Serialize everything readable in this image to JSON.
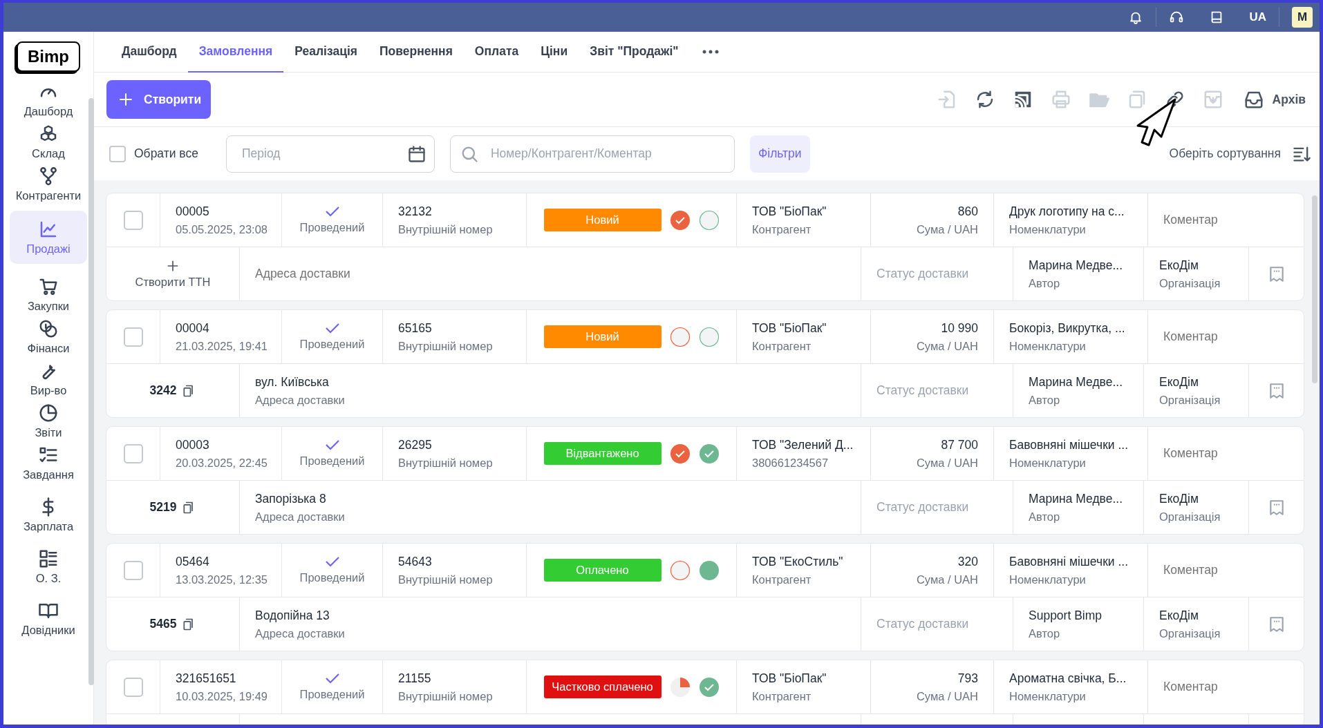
{
  "topbar": {
    "language": "UA",
    "avatar": "M"
  },
  "logo": "Bimp",
  "sidebar": {
    "items": [
      {
        "label": "Дашборд",
        "selected": false
      },
      {
        "label": "Склад",
        "selected": false
      },
      {
        "label": "Контрагенти",
        "selected": false
      },
      {
        "label": "Продажі",
        "selected": true
      },
      {
        "label": "Закупки",
        "selected": false
      },
      {
        "label": "Фінанси",
        "selected": false
      },
      {
        "label": "Вир-во",
        "selected": false
      },
      {
        "label": "Звіти",
        "selected": false
      },
      {
        "label": "Завдання",
        "selected": false
      },
      {
        "label": "Зарплата",
        "selected": false
      },
      {
        "label": "О. З.",
        "selected": false
      },
      {
        "label": "Довідники",
        "selected": false
      }
    ]
  },
  "tabs": [
    {
      "label": "Дашборд",
      "selected": false
    },
    {
      "label": "Замовлення",
      "selected": true
    },
    {
      "label": "Реалізація",
      "selected": false
    },
    {
      "label": "Повернення",
      "selected": false
    },
    {
      "label": "Оплата",
      "selected": false
    },
    {
      "label": "Ціни",
      "selected": false
    },
    {
      "label": "Звіт \"Продажі\"",
      "selected": false
    }
  ],
  "toolbar": {
    "create_button": "Створити",
    "tools": [
      {
        "disabled": true
      },
      {
        "disabled": false
      },
      {
        "disabled": false
      },
      {
        "disabled": true
      },
      {
        "disabled": true
      },
      {
        "disabled": true
      },
      {
        "disabled": false
      },
      {
        "disabled": true
      }
    ],
    "archive_label": "Архів"
  },
  "filters": {
    "select_all": {
      "label": "Обрати все",
      "checked": false
    },
    "period": {
      "placeholder": "Період"
    },
    "search": {
      "placeholder": "Номер/Контрагент/Коментар"
    },
    "filter_button": "Фільтри",
    "sort_label": "Оберіть сортування"
  },
  "orders": [
    {
      "checked": false,
      "number": "00005",
      "date": "05.05.2025, 23:08",
      "posted": "Проведений",
      "internal_number": "32132",
      "internal_label": "Внутрішній номер",
      "status": {
        "label": "Новий",
        "color": "#ff8a00"
      },
      "payment": {
        "paid": true,
        "partial": false
      },
      "shipment": {
        "filled": false,
        "checked": false
      },
      "contractor": "ТОВ \"БіоПак\"",
      "contractor_sub": "Контрагент",
      "sum": "860",
      "sum_label": "Сума / UAH",
      "items": "Друк логотипу на с...",
      "items_label": "Номенклатури",
      "comment": {
        "placeholder": "Коментар"
      },
      "ttn": {
        "kind": "create",
        "label": "Створити ТТН"
      },
      "address": {
        "placeholder": "Адреса доставки"
      },
      "delivery_status": {
        "placeholder": "Статус доставки"
      },
      "author": "Марина Медве...",
      "author_label": "Автор",
      "organization": "ЕкоДім",
      "organization_label": "Організація"
    },
    {
      "checked": false,
      "number": "00004",
      "date": "21.03.2025, 19:41",
      "posted": "Проведений",
      "internal_number": "65165",
      "internal_label": "Внутрішній номер",
      "status": {
        "label": "Новий",
        "color": "#ff8a00"
      },
      "payment": {
        "paid": false,
        "partial": false
      },
      "shipment": {
        "filled": false,
        "checked": false
      },
      "contractor": "ТОВ \"БіоПак\"",
      "contractor_sub": "Контрагент",
      "sum": "10 990",
      "sum_label": "Сума / UAH",
      "items": "Бокоріз, Викрутка, ...",
      "items_label": "Номенклатури",
      "comment": {
        "placeholder": "Коментар"
      },
      "ttn": {
        "kind": "number",
        "label": "3242"
      },
      "address": {
        "value": "вул. Київська",
        "label": "Адреса доставки"
      },
      "delivery_status": {
        "placeholder": "Статус доставки"
      },
      "author": "Марина Медве...",
      "author_label": "Автор",
      "organization": "ЕкоДім",
      "organization_label": "Організація"
    },
    {
      "checked": false,
      "number": "00003",
      "date": "20.03.2025, 22:45",
      "posted": "Проведений",
      "internal_number": "26295",
      "internal_label": "Внутрішній номер",
      "status": {
        "label": "Відвантажено",
        "color": "#33cc33"
      },
      "payment": {
        "paid": true,
        "partial": false
      },
      "shipment": {
        "filled": true,
        "checked": true
      },
      "contractor": "ТОВ \"Зелений Д...",
      "contractor_sub": "380661234567",
      "sum": "87 700",
      "sum_label": "Сума / UAH",
      "items": "Бавовняні мішечки ...",
      "items_label": "Номенклатури",
      "comment": {
        "placeholder": "Коментар"
      },
      "ttn": {
        "kind": "number",
        "label": "5219"
      },
      "address": {
        "value": "Запорізька 8",
        "label": "Адреса доставки"
      },
      "delivery_status": {
        "placeholder": "Статус доставки"
      },
      "author": "Марина Медве...",
      "author_label": "Автор",
      "organization": "ЕкоДім",
      "organization_label": "Організація"
    },
    {
      "checked": false,
      "number": "05464",
      "date": "13.03.2025, 12:35",
      "posted": "Проведений",
      "internal_number": "54643",
      "internal_label": "Внутрішній номер",
      "status": {
        "label": "Оплачено",
        "color": "#33cc33"
      },
      "payment": {
        "paid": false,
        "partial": false
      },
      "shipment": {
        "filled": true,
        "checked": false
      },
      "contractor": "ТОВ \"ЕкоСтиль\"",
      "contractor_sub": "Контрагент",
      "sum": "320",
      "sum_label": "Сума / UAH",
      "items": "Бавовняні мішечки ...",
      "items_label": "Номенклатури",
      "comment": {
        "placeholder": "Коментар"
      },
      "ttn": {
        "kind": "number",
        "label": "5465"
      },
      "address": {
        "value": "Водопійна 13",
        "label": "Адреса доставки"
      },
      "delivery_status": {
        "placeholder": "Статус доставки"
      },
      "author": "Support Bimp",
      "author_label": "Автор",
      "organization": "ЕкоДім",
      "organization_label": "Організація"
    },
    {
      "checked": false,
      "number": "321651651",
      "date": "10.03.2025, 19:49",
      "posted": "Проведений",
      "internal_number": "21155",
      "internal_label": "Внутрішній номер",
      "status": {
        "label": "Частково сплачено",
        "color": "#e01010"
      },
      "payment": {
        "paid": false,
        "partial": true
      },
      "shipment": {
        "filled": true,
        "checked": true
      },
      "contractor": "ТОВ \"БіоПак\"",
      "contractor_sub": "Контрагент",
      "sum": "793",
      "sum_label": "Сума / UAH",
      "items": "Ароматна свічка, Б...",
      "items_label": "Номенклатури",
      "comment": {
        "placeholder": "Коментар"
      }
    }
  ]
}
